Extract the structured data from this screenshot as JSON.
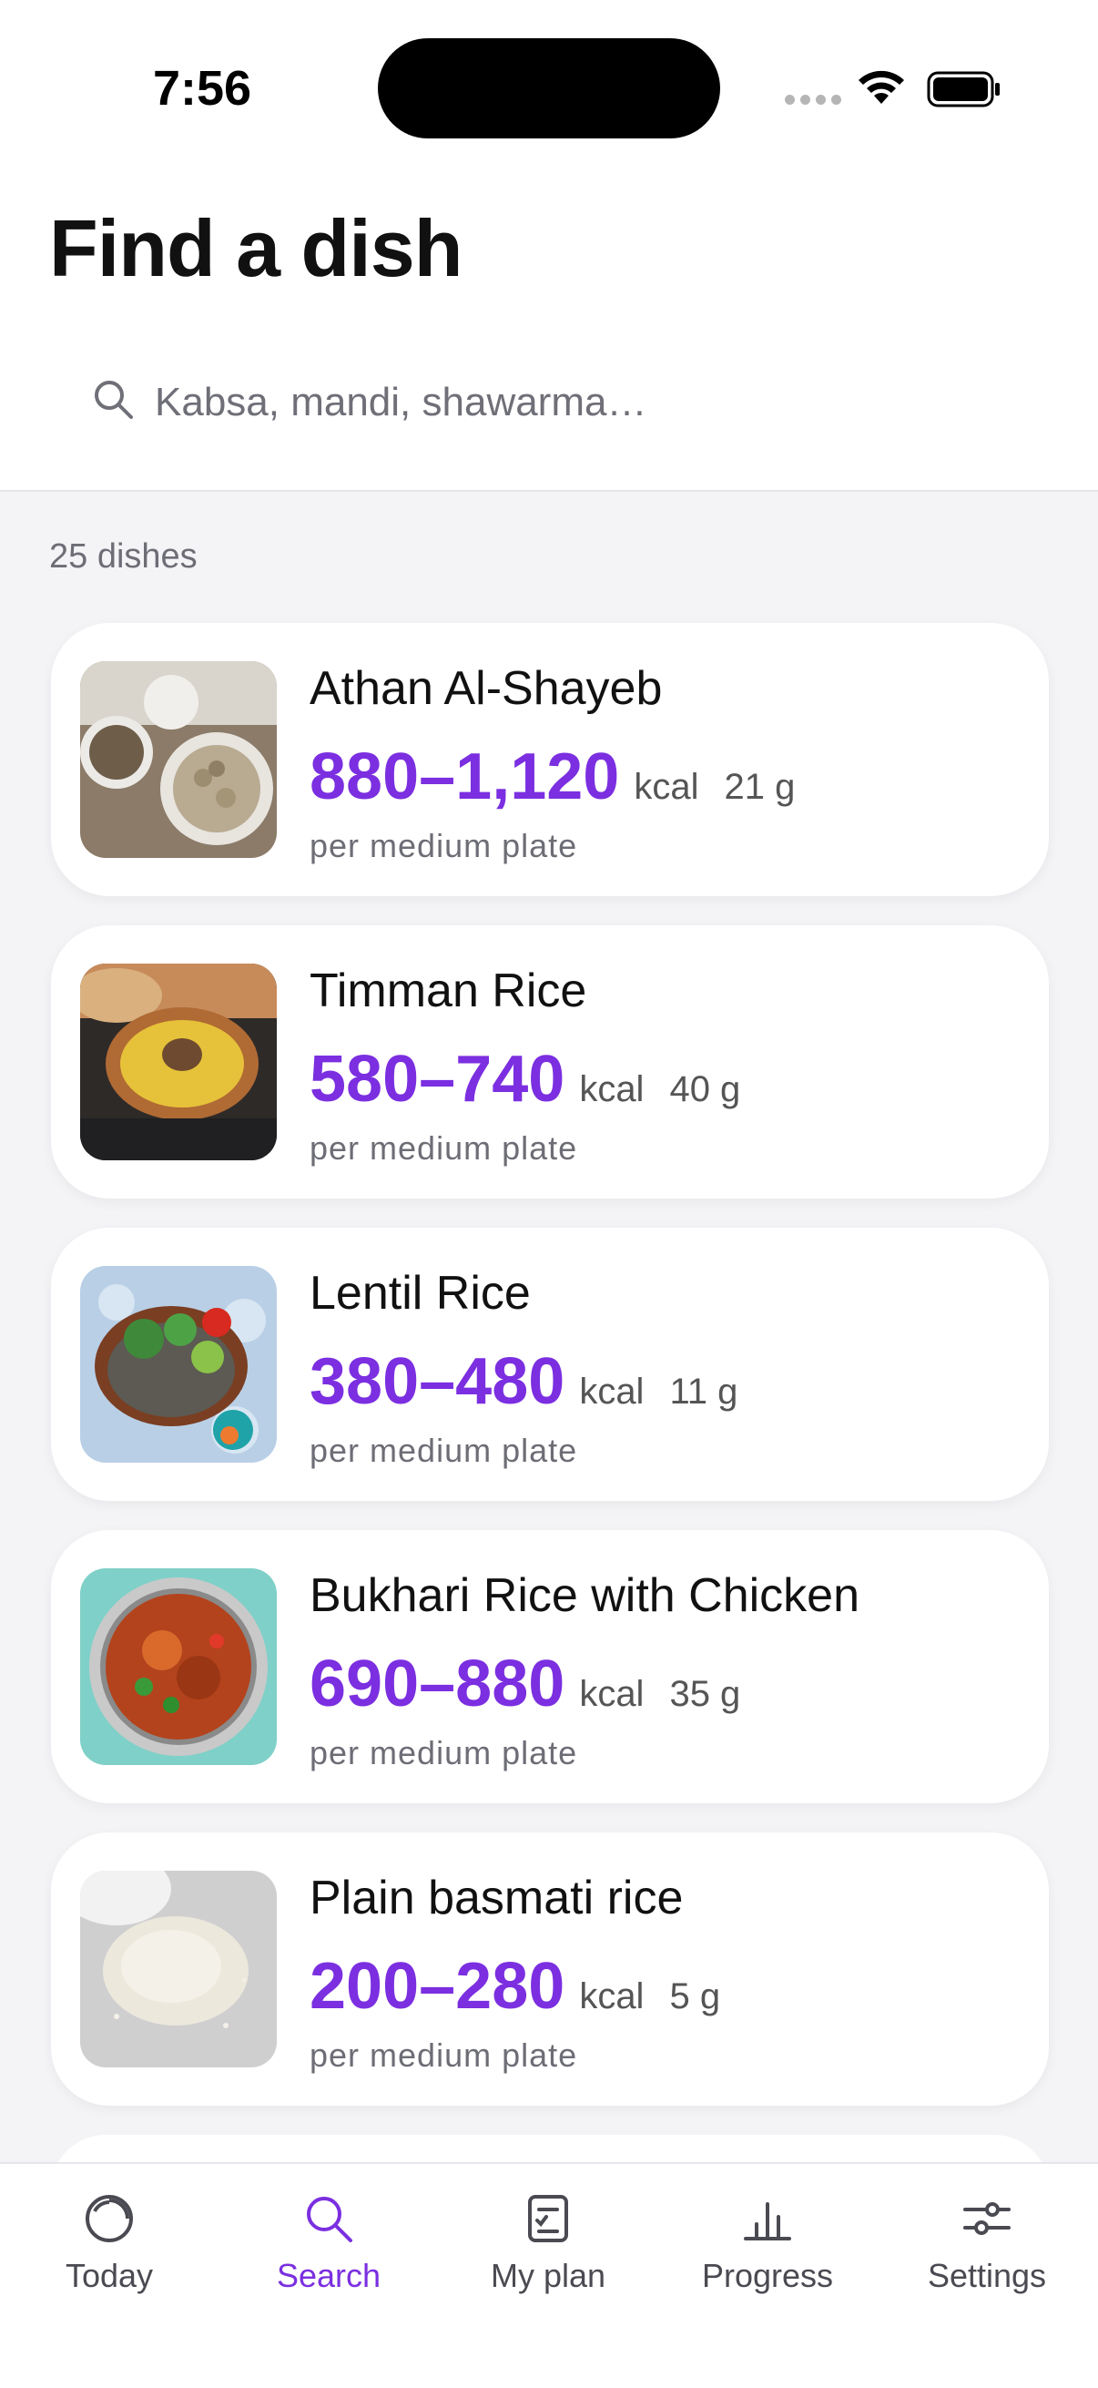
{
  "status_bar": {
    "time": "7:56"
  },
  "header": {
    "title": "Find a dish",
    "search": {
      "placeholder": "Kabsa, mandi, shawarma…",
      "value": ""
    }
  },
  "results": {
    "count_label": "25 dishes",
    "items": [
      {
        "name": "Athan Al-Shayeb",
        "kcal": "880–1,120",
        "unit": "kcal",
        "protein": "21 g",
        "portion": "per medium plate"
      },
      {
        "name": "Timman Rice",
        "kcal": "580–740",
        "unit": "kcal",
        "protein": "40 g",
        "portion": "per medium plate"
      },
      {
        "name": "Lentil Rice",
        "kcal": "380–480",
        "unit": "kcal",
        "protein": "11 g",
        "portion": "per medium plate"
      },
      {
        "name": "Bukhari Rice with Chicken",
        "kcal": "690–880",
        "unit": "kcal",
        "protein": "35 g",
        "portion": "per medium plate"
      },
      {
        "name": "Plain basmati rice",
        "kcal": "200–280",
        "unit": "kcal",
        "protein": "5 g",
        "portion": "per medium plate"
      }
    ]
  },
  "tabbar": {
    "tabs": [
      {
        "label": "Today",
        "icon": "today-ring-icon"
      },
      {
        "label": "Search",
        "icon": "search-icon",
        "active": true
      },
      {
        "label": "My plan",
        "icon": "clipboard-list-icon"
      },
      {
        "label": "Progress",
        "icon": "bar-chart-icon"
      },
      {
        "label": "Settings",
        "icon": "sliders-icon"
      }
    ]
  },
  "colors": {
    "accent": "#7b2fe0",
    "background": "#f4f4f7",
    "card": "#ffffff"
  }
}
